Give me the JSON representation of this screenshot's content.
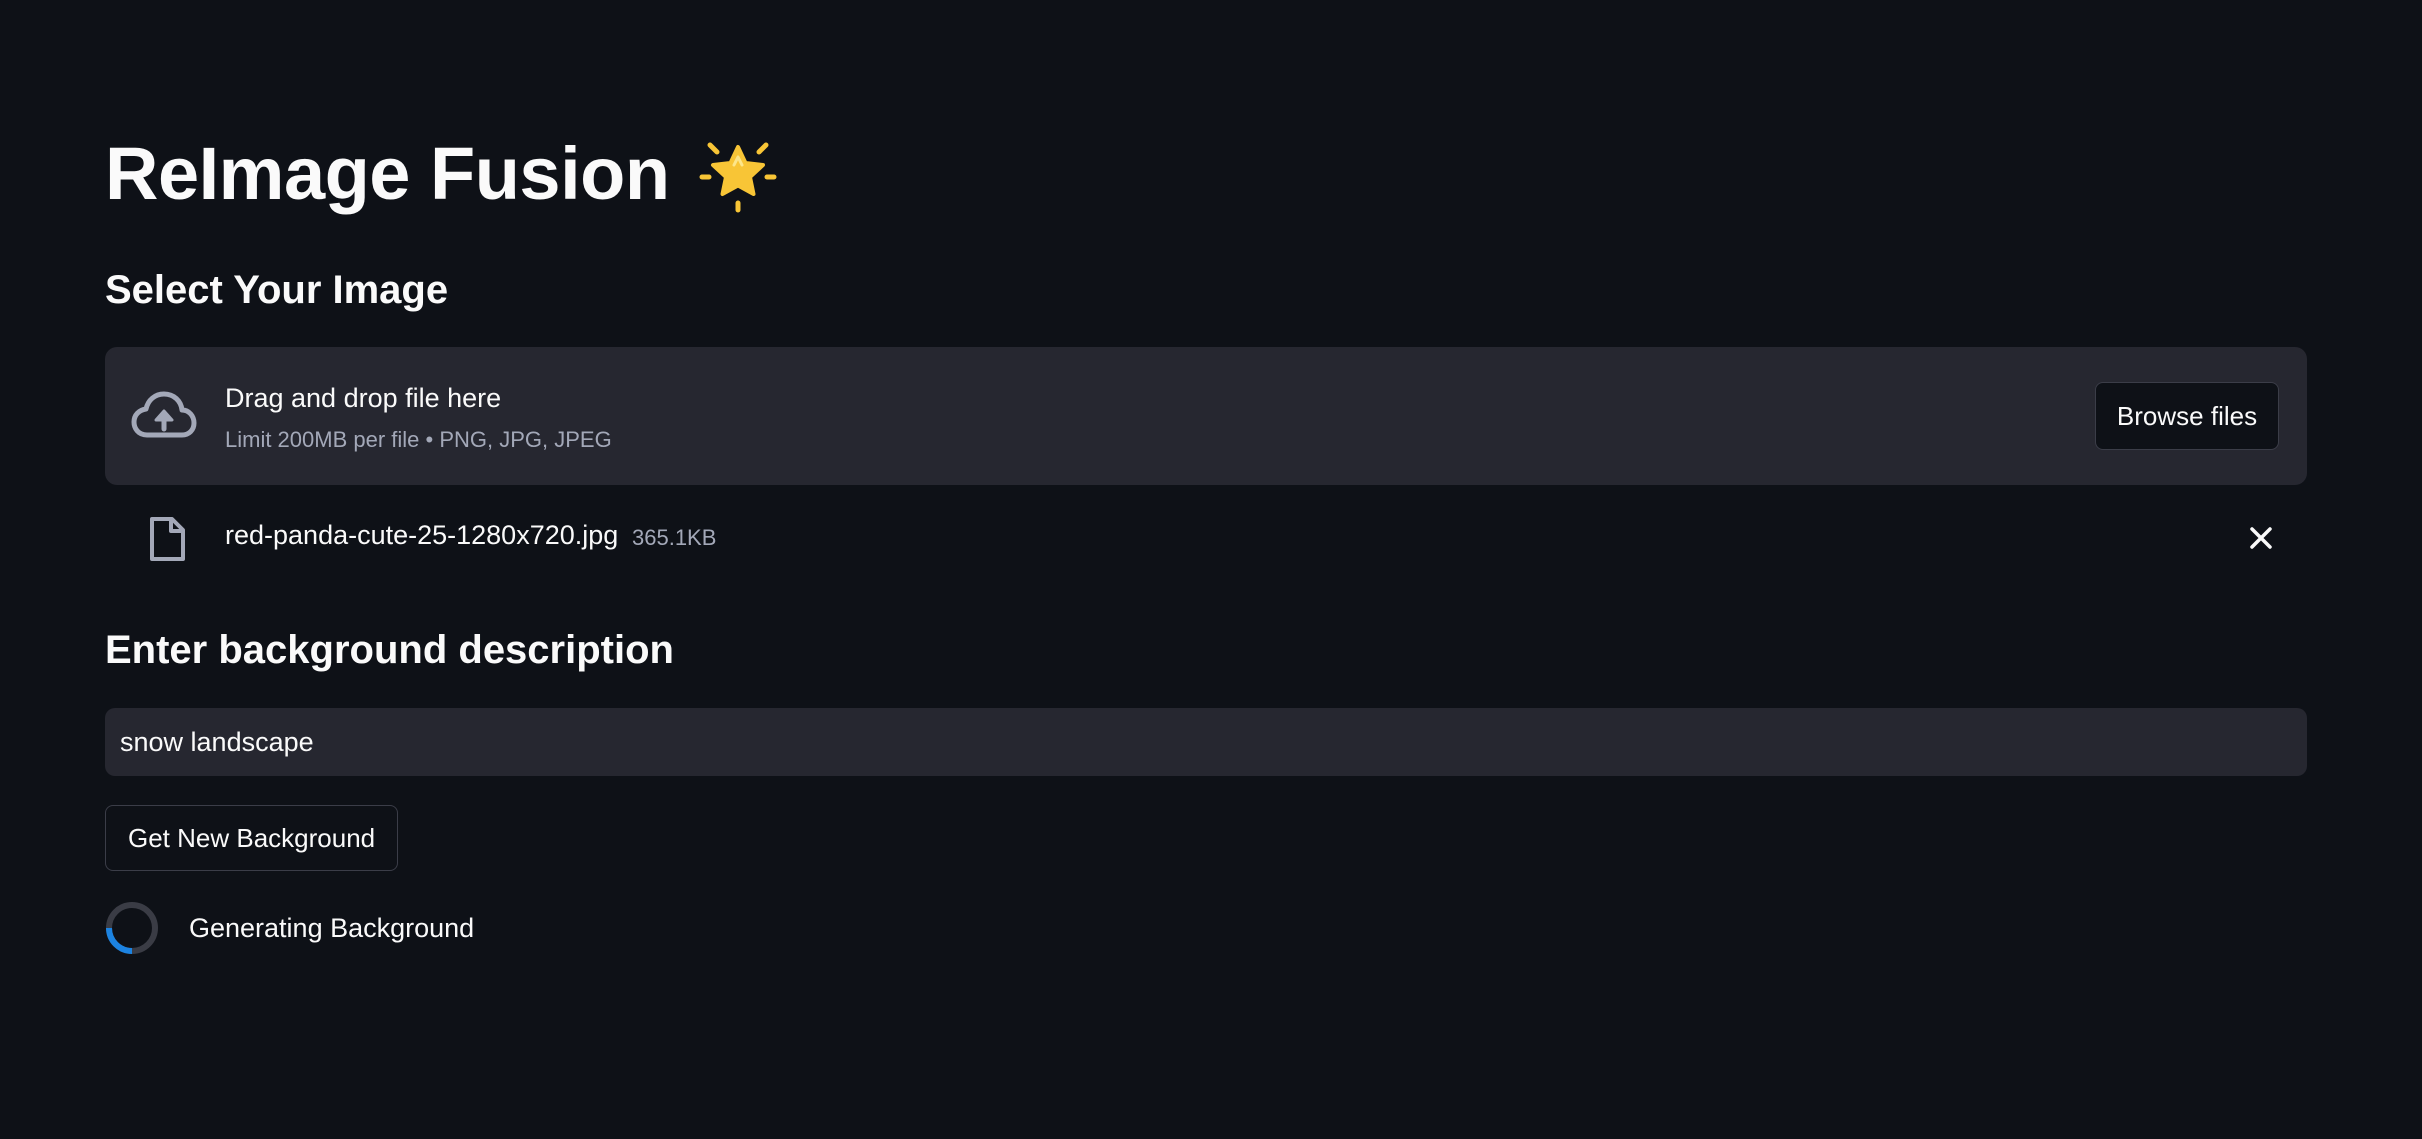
{
  "app": {
    "title": "ReImage Fusion",
    "title_icon": "glowing-star-icon"
  },
  "upload": {
    "heading": "Select Your Image",
    "drop_label": "Drag and drop file here",
    "limit_text": "Limit 200MB per file • PNG, JPG, JPEG",
    "browse_label": "Browse files",
    "upload_icon": "cloud-upload-icon"
  },
  "uploaded_file": {
    "name": "red-panda-cute-25-1280x720.jpg",
    "size": "365.1KB",
    "file_icon": "file-icon",
    "remove_icon": "close-icon"
  },
  "background": {
    "heading": "Enter background description",
    "input_value": "snow landscape",
    "button_label": "Get New Background"
  },
  "status": {
    "spinner_text": "Generating Background",
    "spinner_icon": "spinner-icon"
  },
  "colors": {
    "page_bg": "#0e1117",
    "surface": "#262730",
    "text": "#fafafa",
    "muted": "#a3a8b8",
    "spinner_accent": "#1c83e1",
    "star": "#f8c536"
  }
}
